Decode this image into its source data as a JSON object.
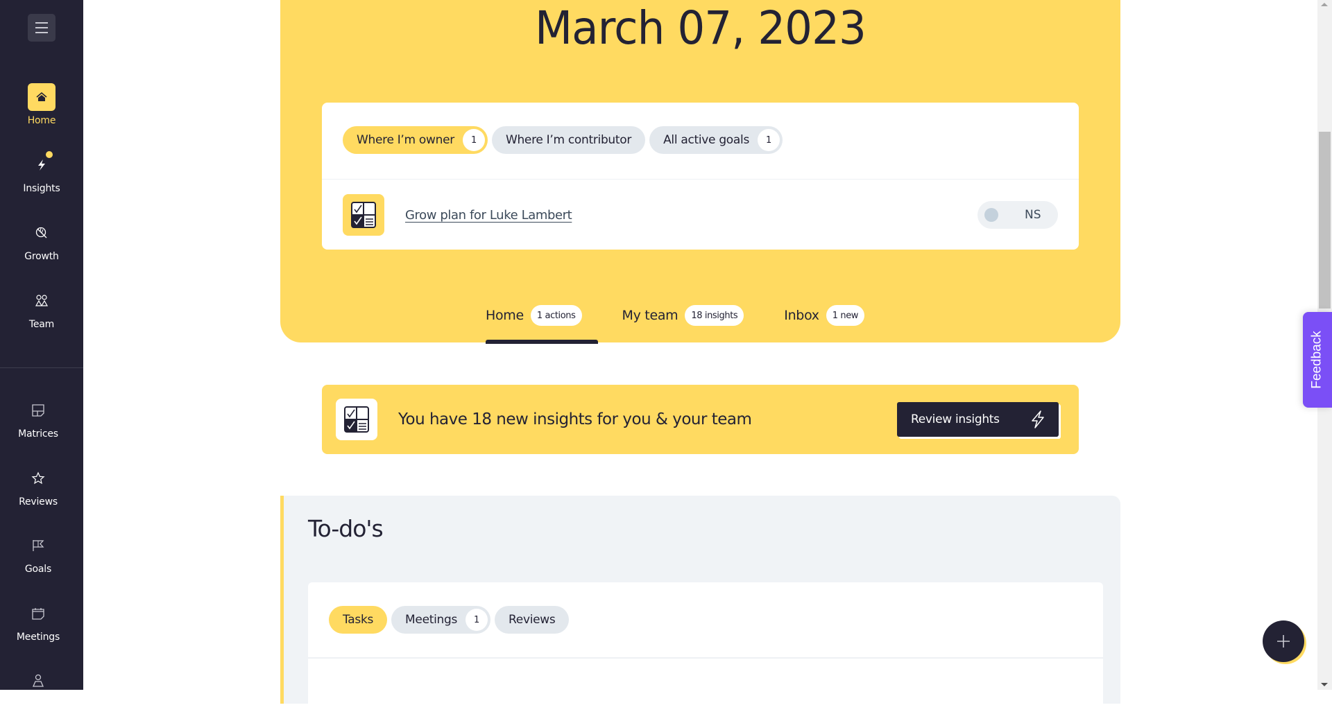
{
  "sidebar": {
    "menu_icon": "hamburger-menu-icon",
    "items": [
      {
        "label": "Home",
        "icon": "home-icon",
        "active": true
      },
      {
        "label": "Insights",
        "icon": "lightning-icon",
        "notification": true
      },
      {
        "label": "Growth",
        "icon": "leaf-icon"
      },
      {
        "label": "Team",
        "icon": "team-icon"
      },
      {
        "label": "Matrices",
        "icon": "matrix-icon"
      },
      {
        "label": "Reviews",
        "icon": "star-icon"
      },
      {
        "label": "Goals",
        "icon": "flag-icon"
      },
      {
        "label": "Meetings",
        "icon": "calendar-icon"
      },
      {
        "label": "",
        "icon": "user-icon"
      }
    ]
  },
  "hero": {
    "date": "March 07, 2023",
    "goal_filters": [
      {
        "label": "Where I’m owner",
        "count": "1",
        "active": true
      },
      {
        "label": "Where I’m contributor"
      },
      {
        "label": "All active goals",
        "count": "1"
      }
    ],
    "goals": [
      {
        "title": "Grow plan for Luke Lambert",
        "status": "NS",
        "icon": "checklist-icon"
      }
    ],
    "tabs": [
      {
        "label": "Home",
        "badge": "1 actions",
        "active": true
      },
      {
        "label": "My team",
        "badge": "18 insights"
      },
      {
        "label": "Inbox",
        "badge": "1 new"
      }
    ]
  },
  "insights_banner": {
    "text": "You have 18 new insights for you & your team",
    "button_label": "Review insights",
    "button_icon": "lightning-icon"
  },
  "todos": {
    "title": "To-do's",
    "tabs": [
      {
        "label": "Tasks",
        "active": true
      },
      {
        "label": "Meetings",
        "count": "1"
      },
      {
        "label": "Reviews"
      }
    ]
  },
  "feedback_label": "Feedback",
  "fab_icon": "plus-icon",
  "colors": {
    "accent": "#ffda61",
    "sidebar": "#232234",
    "feedback": "#7b4ff6"
  }
}
